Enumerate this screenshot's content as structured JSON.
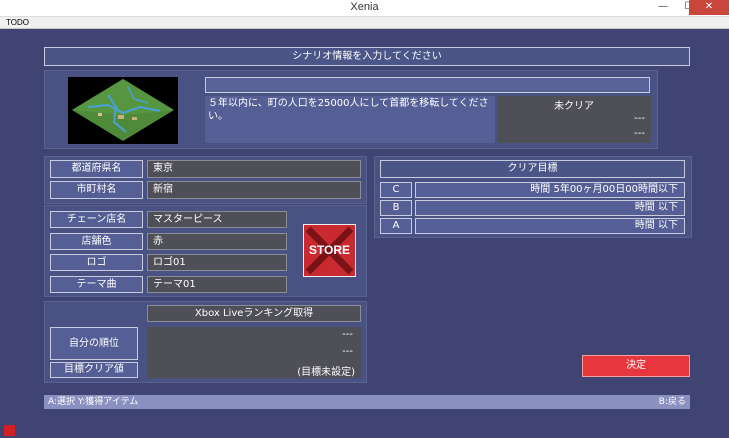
{
  "window": {
    "title": "Xenia",
    "min": "—",
    "max": "☐",
    "close": "✕"
  },
  "menu": {
    "todo": "TODO"
  },
  "header": {
    "title": "シナリオ情報を入力してください"
  },
  "scenario": {
    "description": "５年以内に、町の人口を25000人にして首都を移転してください。",
    "status": "未クリア",
    "line2": "---",
    "line3": "---"
  },
  "location": {
    "pref_label": "都道府県名",
    "pref_value": "東京",
    "city_label": "市町村名",
    "city_value": "新宿"
  },
  "chain": {
    "name_label": "チェーン店名",
    "name_value": "マスターピース",
    "color_label": "店舗色",
    "color_value": "赤",
    "logo_label": "ロゴ",
    "logo_value": "ロゴ01",
    "theme_label": "テーマ曲",
    "theme_value": "テーマ01"
  },
  "store_logo": {
    "text": "STORE"
  },
  "clear_goals": {
    "title": "クリア目標",
    "rows": [
      {
        "rank": "C",
        "value": "時間 5年00ヶ月00日00時間以下"
      },
      {
        "rank": "B",
        "value": "時間 以下"
      },
      {
        "rank": "A",
        "value": "時間 以下"
      }
    ]
  },
  "ranking": {
    "title": "Xbox Liveランキング取得",
    "my_rank_label": "自分の順位",
    "goal_value_label": "目標クリア値",
    "line1": "---",
    "line2": "---",
    "goal_value": "(目標未設定)"
  },
  "decide_button": {
    "label": "決定"
  },
  "footer": {
    "left": "A:選択 Y:獲得アイテム",
    "right": "B:戻る"
  },
  "colors": {
    "accent_red": "#e8373c",
    "panel_bg": "#4a5283",
    "background": "#3f4473"
  }
}
